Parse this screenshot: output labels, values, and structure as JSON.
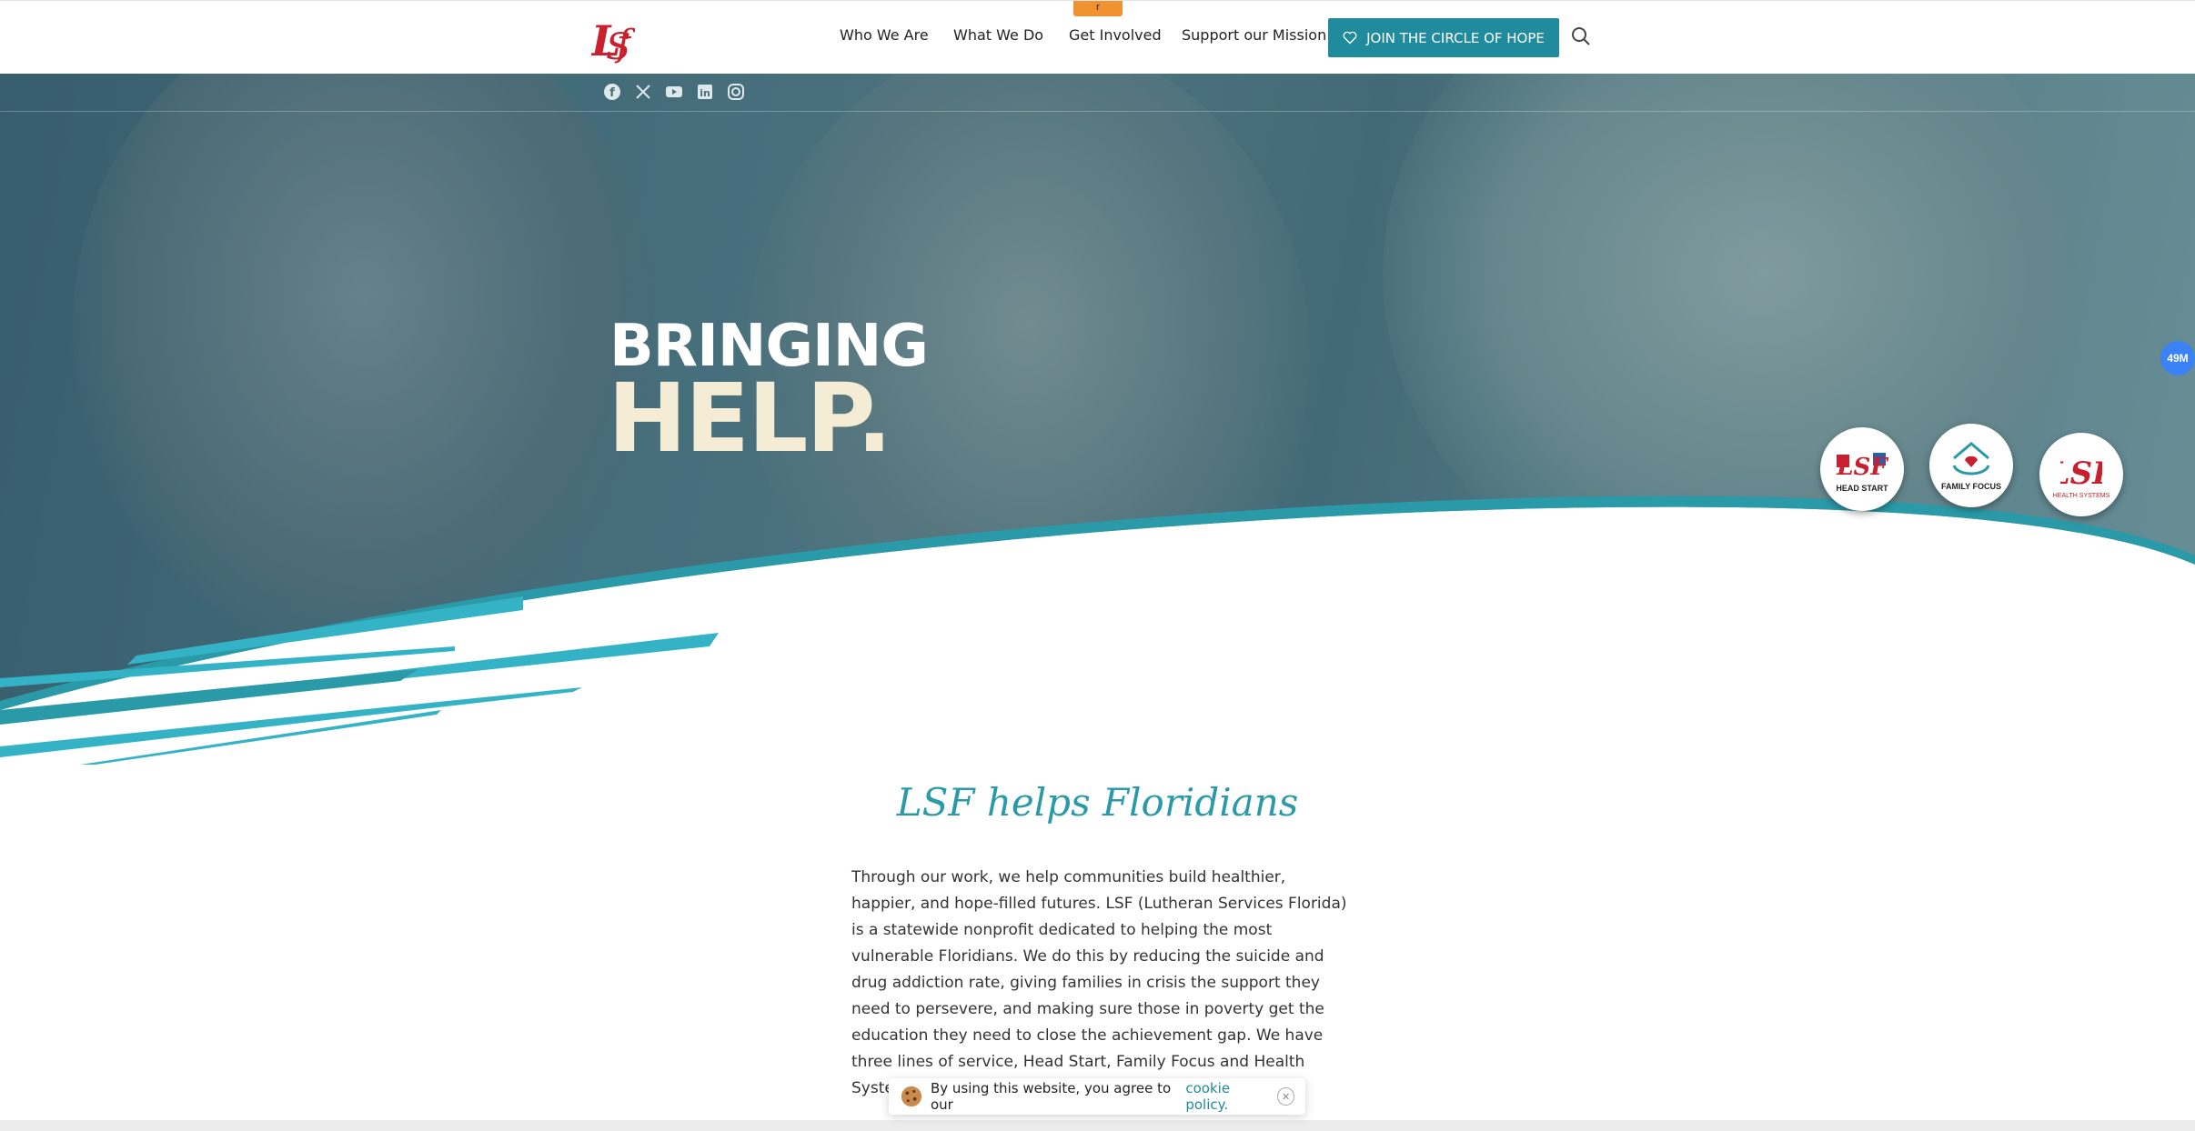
{
  "header": {
    "logo_text": "LSF",
    "nav": [
      "Who We Are",
      "What We Do",
      "Get Involved",
      "Support our Mission"
    ],
    "orange_tab_text": "r",
    "cta_label": "JOIN THE CIRCLE OF HOPE",
    "search_icon": "search-icon"
  },
  "social": [
    "facebook-icon",
    "x-icon",
    "youtube-icon",
    "linkedin-icon",
    "instagram-icon"
  ],
  "hero": {
    "line1": "BRINGING",
    "line2": "HELP.",
    "badges": [
      {
        "label": "HEAD START"
      },
      {
        "label": "FAMILY FOCUS"
      },
      {
        "label": "HEALTH SYSTEMS"
      }
    ]
  },
  "side_badge": "49M",
  "intro": {
    "heading": "LSF helps Floridians",
    "text": "Through our work, we help communities build healthier, happier, and hope-filled futures. LSF (Lutheran Services Florida) is a statewide nonprofit dedicated to helping the most vulnerable Floridians. We do this by reducing the suicide and drug addiction rate, giving families in crisis the support they need to persevere, and making sure those in poverty get the education they need to close the achievement gap. We have three lines of service, Head Start, Family Focus and Health Systems."
  },
  "cookie": {
    "text": "By using this website, you agree to our",
    "link": "cookie policy."
  },
  "colors": {
    "teal": "#1f8b9c",
    "brand_red": "#c8202f",
    "heading_teal": "#2a9aa8",
    "hero_cream": "#f5ecd5"
  }
}
